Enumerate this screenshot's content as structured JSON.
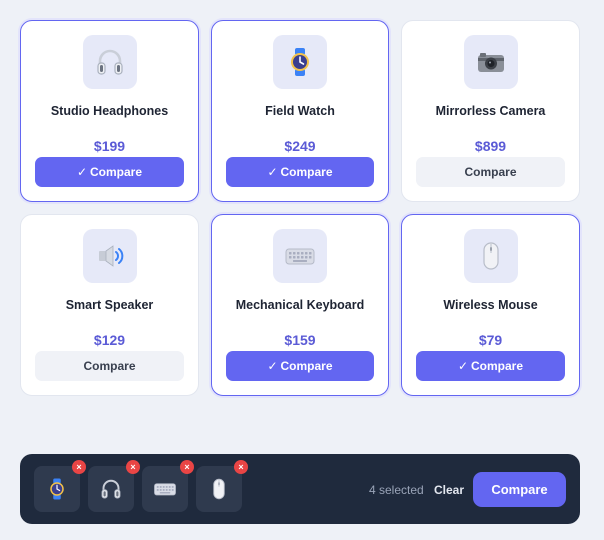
{
  "products": [
    {
      "name": "Studio Headphones",
      "price": "$199",
      "button_label": "Compare",
      "selected": true,
      "icon": "headphones-icon"
    },
    {
      "name": "Field Watch",
      "price": "$249",
      "button_label": "Compare",
      "selected": true,
      "icon": "watch-icon"
    },
    {
      "name": "Mirrorless Camera",
      "price": "$899",
      "button_label": "Compare",
      "selected": false,
      "icon": "camera-icon"
    },
    {
      "name": "Smart Speaker",
      "price": "$129",
      "button_label": "Compare",
      "selected": false,
      "icon": "speaker-icon"
    },
    {
      "name": "Mechanical Keyboard",
      "price": "$159",
      "button_label": "Compare",
      "selected": true,
      "icon": "keyboard-icon"
    },
    {
      "name": "Wireless Mouse",
      "price": "$79",
      "button_label": "Compare",
      "selected": true,
      "icon": "mouse-icon"
    }
  ],
  "tray": {
    "slots": [
      {
        "icon": "watch-icon",
        "remove_label": "×"
      },
      {
        "icon": "headphones-icon",
        "remove_label": "×"
      },
      {
        "icon": "keyboard-icon",
        "remove_label": "×"
      },
      {
        "icon": "mouse-icon",
        "remove_label": "×"
      }
    ],
    "selected_count": "4 selected",
    "clear_label": "Clear",
    "compare_label": "Compare"
  },
  "colors": {
    "accent": "#6366f1",
    "tray_bg": "#1f2a3d",
    "remove_badge": "#e94545",
    "price": "#5b5bd6"
  }
}
